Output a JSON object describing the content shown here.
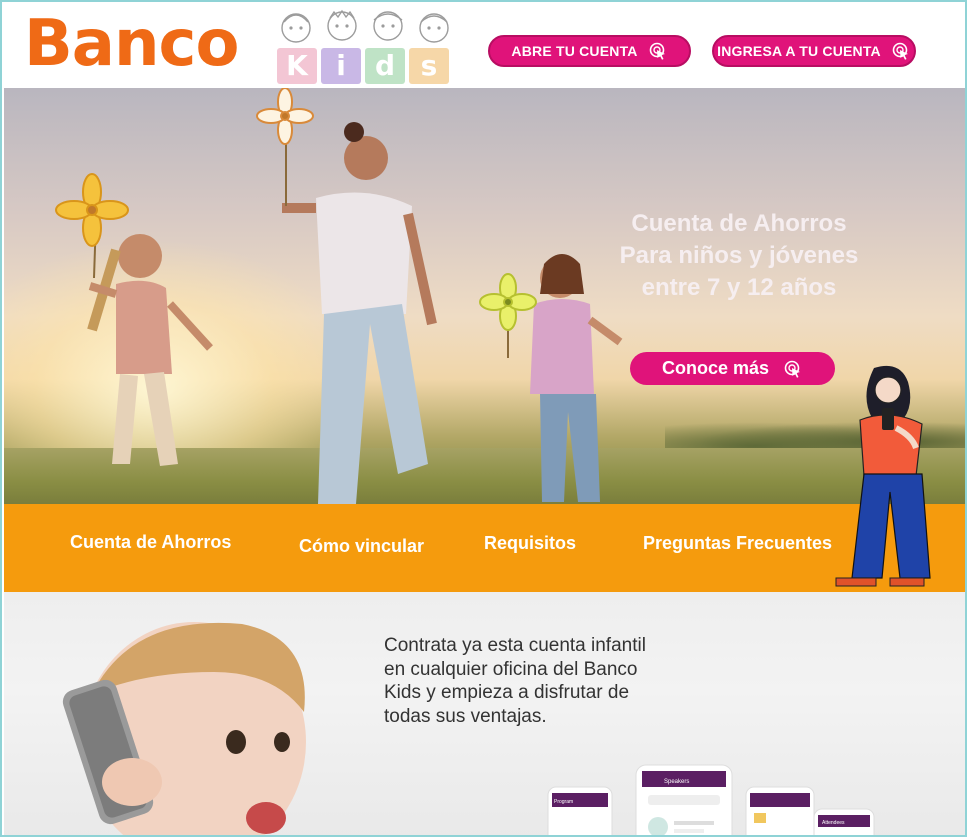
{
  "header": {
    "logo_text": "Banco",
    "kids_letters": [
      "K",
      "i",
      "d",
      "s"
    ],
    "kids_colors": [
      "#f3c6d4",
      "#c9b8e6",
      "#bfe3c6",
      "#f6d7a8"
    ],
    "open_account_label": "ABRE TU CUENTA",
    "login_label": "INGRESA A TU CUENTA"
  },
  "hero": {
    "title_lines": [
      "Cuenta de  Ahorros",
      "Para niños y jóvenes",
      "entre 7 y 12 años"
    ],
    "cta_label": "Conoce más"
  },
  "nav": {
    "items": [
      "Cuenta de Ahorros",
      "Cómo vincular",
      "Requisitos",
      "Preguntas Frecuentes"
    ]
  },
  "promo": {
    "text": "Contrata ya esta cuenta infantil en cualquier oficina del Banco Kids y empieza a disfrutar de todas sus ventajas."
  },
  "phones": {
    "screen_titles": [
      "Program",
      "Speakers",
      "",
      "Attendees"
    ]
  },
  "colors": {
    "brand_orange": "#ef6a16",
    "accent_pink": "#e0137a",
    "nav_orange": "#f59b0d",
    "phone_purple": "#5b1f63"
  },
  "icons": {
    "cursor": "cursor-click-icon"
  }
}
